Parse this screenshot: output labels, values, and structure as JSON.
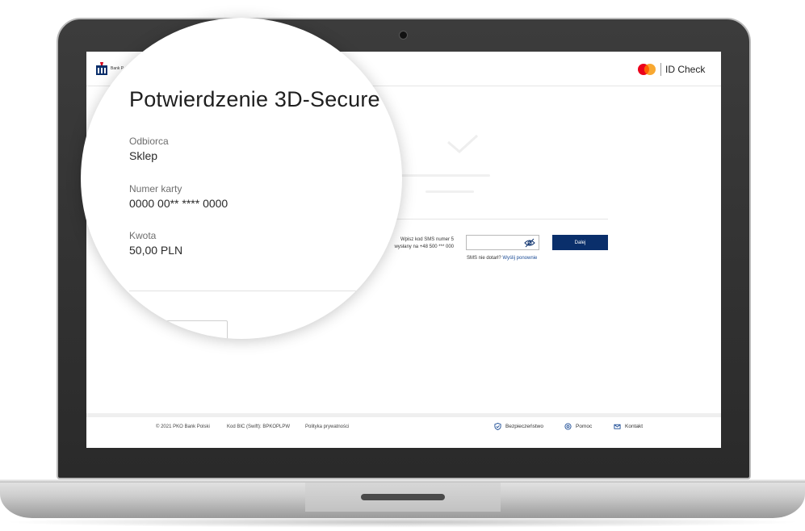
{
  "colors": {
    "brand_navy": "#0a2f6b",
    "link_blue": "#1a4b95",
    "mastercard_red": "#eb001b",
    "mastercard_orange": "#f79e1b"
  },
  "header": {
    "bank_name": "Bank P",
    "bank_logo_icon": "pko-logo-icon",
    "mastercard_icon": "mastercard-logo-icon",
    "id_check_label": "ID Check"
  },
  "magnifier": {
    "title": "Potwierdzenie 3D-Secure",
    "recipient_label": "Odbiorca",
    "recipient_value": "Sklep",
    "card_label": "Numer karty",
    "card_value": "0000 00** **** 0000",
    "amount_label": "Kwota",
    "amount_value": "50,00 PLN"
  },
  "sms_form": {
    "label_line1": "Wpisz kod SMS numer 5",
    "label_line2": "wysłany na +48 500 *** 000",
    "code_value": "",
    "toggle_icon": "eye-slash-icon",
    "submit_label": "Dalej",
    "not_received_text": "SMS nie dotarł?",
    "resend_link": "Wyślij ponownie"
  },
  "footer": {
    "copyright": "© 2021 PKO Bank Polski",
    "bic": "Kod BIC (Swift): BPKOPLPW",
    "privacy": "Polityka prywatności",
    "security": "Bezpieczeństwo",
    "security_icon": "shield-check-icon",
    "help": "Pomoc",
    "help_icon": "lifebuoy-icon",
    "contact": "Kontakt",
    "contact_icon": "envelope-icon"
  }
}
